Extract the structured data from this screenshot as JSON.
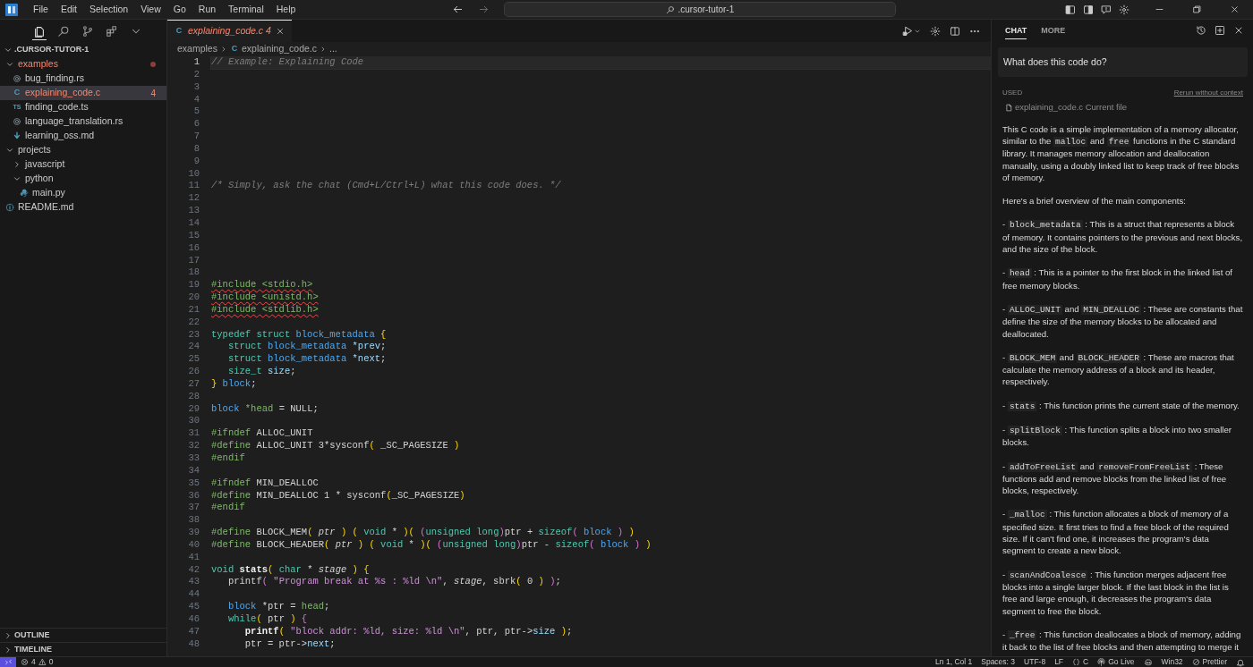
{
  "title_bar": {
    "menu": [
      "File",
      "Edit",
      "Selection",
      "View",
      "Go",
      "Run",
      "Terminal",
      "Help"
    ],
    "search": {
      "value": ".cursor-tutor-1"
    }
  },
  "activity": [
    {
      "kind": "files",
      "selected": true
    },
    {
      "kind": "search",
      "selected": false
    },
    {
      "kind": "source-control",
      "selected": false
    },
    {
      "kind": "extensions",
      "selected": false
    },
    {
      "kind": "more",
      "selected": false
    }
  ],
  "explorer": {
    "title": ".CURSOR-TUTOR-1",
    "expanded": true,
    "tree": [
      {
        "label": "examples",
        "kind": "folder",
        "expanded": true,
        "selected": false,
        "error": true,
        "modified": true,
        "children": [
          {
            "label": "bug_finding.rs",
            "kind": "rust",
            "selected": false,
            "error": false
          },
          {
            "label": "explaining_code.c",
            "kind": "c",
            "icon_text": "C",
            "badge": "4",
            "selected": true,
            "error": true
          },
          {
            "label": "finding_code.ts",
            "kind": "ts",
            "icon_text": "TS",
            "selected": false,
            "error": false
          },
          {
            "label": "language_translation.rs",
            "kind": "rust",
            "selected": false,
            "error": false
          },
          {
            "label": "learning_oss.md",
            "kind": "markdown",
            "selected": false,
            "error": false
          }
        ]
      },
      {
        "label": "projects",
        "kind": "folder",
        "expanded": true,
        "selected": false,
        "error": false,
        "children": [
          {
            "label": "javascript",
            "kind": "folder",
            "expanded": false,
            "selected": false,
            "error": false
          },
          {
            "label": "python",
            "kind": "folder",
            "expanded": true,
            "selected": false,
            "error": false,
            "children": [
              {
                "label": "main.py",
                "kind": "python",
                "selected": false,
                "error": false
              }
            ]
          }
        ]
      },
      {
        "label": "README.md",
        "kind": "info",
        "selected": false,
        "error": false
      }
    ]
  },
  "sidebar_sections": [
    {
      "label": "OUTLINE",
      "expanded": false
    },
    {
      "label": "TIMELINE",
      "expanded": false
    }
  ],
  "editor": {
    "tabs": [
      {
        "label": "explaining_code.c",
        "icon_text": "C",
        "badge": "4",
        "selected": true,
        "error": true
      }
    ],
    "breadcrumb": [
      {
        "label": "examples"
      },
      {
        "label": "explaining_code.c",
        "icon_text": "C"
      },
      {
        "label": "..."
      }
    ],
    "lines": [
      {
        "number": "1",
        "current": true,
        "tokens": [
          {
            "kind": "cm",
            "text": "// Example: Explaining Code"
          }
        ]
      },
      {
        "number": "2"
      },
      {
        "number": "3"
      },
      {
        "number": "4"
      },
      {
        "number": "5"
      },
      {
        "number": "6"
      },
      {
        "number": "7"
      },
      {
        "number": "8"
      },
      {
        "number": "9"
      },
      {
        "number": "10"
      },
      {
        "number": "11",
        "tokens": [
          {
            "kind": "cm",
            "text": "/* Simply, ask the chat (Cmd+L/Ctrl+L) what this code does. */"
          }
        ]
      },
      {
        "number": "12"
      },
      {
        "number": "13"
      },
      {
        "number": "14"
      },
      {
        "number": "15"
      },
      {
        "number": "16"
      },
      {
        "number": "17"
      },
      {
        "number": "18"
      },
      {
        "number": "19",
        "error": true,
        "tokens": [
          {
            "kind": "pp",
            "text": "#include <stdio.h>"
          }
        ]
      },
      {
        "number": "20",
        "error": true,
        "tokens": [
          {
            "kind": "pp",
            "text": "#include <unistd.h>"
          }
        ]
      },
      {
        "number": "21",
        "error": true,
        "tokens": [
          {
            "kind": "pp",
            "text": "#include <stdlib.h>"
          }
        ]
      },
      {
        "number": "22"
      },
      {
        "number": "23",
        "tokens": [
          {
            "kind": "kw",
            "text": "typedef struct "
          },
          {
            "kind": "ty",
            "text": "block_metadata "
          },
          {
            "kind": "y",
            "text": "{"
          }
        ]
      },
      {
        "number": "24",
        "tokens": [
          {
            "kind": "kw",
            "text": "   struct "
          },
          {
            "kind": "ty",
            "text": "block_metadata "
          },
          {
            "kind": "v",
            "text": "*prev"
          },
          {
            "kind": "w",
            "text": ";"
          }
        ]
      },
      {
        "number": "25",
        "tokens": [
          {
            "kind": "kw",
            "text": "   struct "
          },
          {
            "kind": "ty",
            "text": "block_metadata "
          },
          {
            "kind": "v",
            "text": "*next"
          },
          {
            "kind": "w",
            "text": ";"
          }
        ]
      },
      {
        "number": "26",
        "tokens": [
          {
            "kind": "kw",
            "text": "   size_t "
          },
          {
            "kind": "v",
            "text": "size"
          },
          {
            "kind": "w",
            "text": ";"
          }
        ]
      },
      {
        "number": "27",
        "tokens": [
          {
            "kind": "y",
            "text": "}"
          },
          {
            "kind": "ty",
            "text": " block"
          },
          {
            "kind": "w",
            "text": ";"
          }
        ]
      },
      {
        "number": "28"
      },
      {
        "number": "29",
        "tokens": [
          {
            "kind": "ty",
            "text": "block "
          },
          {
            "kind": "pp",
            "text": "*head"
          },
          {
            "kind": "w",
            "text": " = NULL;"
          }
        ]
      },
      {
        "number": "30"
      },
      {
        "number": "31",
        "tokens": [
          {
            "kind": "pp",
            "text": "#ifndef "
          },
          {
            "kind": "w",
            "text": "ALLOC_UNIT"
          }
        ]
      },
      {
        "number": "32",
        "tokens": [
          {
            "kind": "pp",
            "text": "#define "
          },
          {
            "kind": "w",
            "text": "ALLOC_UNIT "
          },
          {
            "kind": "n",
            "text": "3"
          },
          {
            "kind": "w",
            "text": "*sysconf"
          },
          {
            "kind": "y",
            "text": "("
          },
          {
            "kind": "w",
            "text": " _SC_PAGESIZE "
          },
          {
            "kind": "y",
            "text": ")"
          }
        ]
      },
      {
        "number": "33",
        "tokens": [
          {
            "kind": "pp",
            "text": "#endif"
          }
        ]
      },
      {
        "number": "34"
      },
      {
        "number": "35",
        "tokens": [
          {
            "kind": "pp",
            "text": "#ifndef "
          },
          {
            "kind": "w",
            "text": "MIN_DEALLOC"
          }
        ]
      },
      {
        "number": "36",
        "tokens": [
          {
            "kind": "pp",
            "text": "#define "
          },
          {
            "kind": "w",
            "text": "MIN_DEALLOC "
          },
          {
            "kind": "n",
            "text": "1"
          },
          {
            "kind": "w",
            "text": " * sysconf"
          },
          {
            "kind": "y",
            "text": "("
          },
          {
            "kind": "w",
            "text": "_SC_PAGESIZE"
          },
          {
            "kind": "y",
            "text": ")"
          }
        ]
      },
      {
        "number": "37",
        "tokens": [
          {
            "kind": "pp",
            "text": "#endif"
          }
        ]
      },
      {
        "number": "38"
      },
      {
        "number": "39",
        "tokens": [
          {
            "kind": "pp",
            "text": "#define "
          },
          {
            "kind": "w",
            "text": "BLOCK_MEM"
          },
          {
            "kind": "y",
            "text": "( "
          },
          {
            "kind": "it",
            "text": "ptr"
          },
          {
            "kind": "y",
            "text": " ) "
          },
          {
            "kind": "y",
            "text": "( "
          },
          {
            "kind": "kw",
            "text": "void"
          },
          {
            "kind": "w",
            "text": " * "
          },
          {
            "kind": "y",
            "text": ")( "
          },
          {
            "kind": "m",
            "text": "("
          },
          {
            "kind": "kw",
            "text": "unsigned long"
          },
          {
            "kind": "m",
            "text": ")"
          },
          {
            "kind": "w",
            "text": "ptr + "
          },
          {
            "kind": "kw",
            "text": "sizeof"
          },
          {
            "kind": "m",
            "text": "( "
          },
          {
            "kind": "ty",
            "text": "block"
          },
          {
            "kind": "m",
            "text": " )"
          },
          {
            "kind": "y",
            "text": " )"
          }
        ]
      },
      {
        "number": "40",
        "tokens": [
          {
            "kind": "pp",
            "text": "#define "
          },
          {
            "kind": "w",
            "text": "BLOCK_HEADER"
          },
          {
            "kind": "y",
            "text": "( "
          },
          {
            "kind": "it",
            "text": "ptr"
          },
          {
            "kind": "y",
            "text": " ) "
          },
          {
            "kind": "y",
            "text": "( "
          },
          {
            "kind": "kw",
            "text": "void"
          },
          {
            "kind": "w",
            "text": " * "
          },
          {
            "kind": "y",
            "text": ")( "
          },
          {
            "kind": "m",
            "text": "("
          },
          {
            "kind": "kw",
            "text": "unsigned long"
          },
          {
            "kind": "m",
            "text": ")"
          },
          {
            "kind": "w",
            "text": "ptr - "
          },
          {
            "kind": "kw",
            "text": "sizeof"
          },
          {
            "kind": "m",
            "text": "( "
          },
          {
            "kind": "ty",
            "text": "block"
          },
          {
            "kind": "m",
            "text": " )"
          },
          {
            "kind": "y",
            "text": " )"
          }
        ]
      },
      {
        "number": "41"
      },
      {
        "number": "42",
        "tokens": [
          {
            "kind": "kw",
            "text": "void "
          },
          {
            "kind": "fb",
            "text": "stats"
          },
          {
            "kind": "y",
            "text": "("
          },
          {
            "kind": "kw",
            "text": " char"
          },
          {
            "kind": "w",
            "text": " * "
          },
          {
            "kind": "it",
            "text": "stage"
          },
          {
            "kind": "y",
            "text": " ) {"
          }
        ]
      },
      {
        "number": "43",
        "tokens": [
          {
            "kind": "w",
            "text": "   printf"
          },
          {
            "kind": "m",
            "text": "("
          },
          {
            "kind": "s",
            "text": " \"Program break at %s : %ld \\n\""
          },
          {
            "kind": "w",
            "text": ", "
          },
          {
            "kind": "it",
            "text": "stage"
          },
          {
            "kind": "w",
            "text": ", sbrk"
          },
          {
            "kind": "y",
            "text": "("
          },
          {
            "kind": "n",
            "text": " 0 "
          },
          {
            "kind": "y",
            "text": ")"
          },
          {
            "kind": "m",
            "text": " )"
          },
          {
            "kind": "w",
            "text": ";"
          }
        ]
      },
      {
        "number": "44"
      },
      {
        "number": "45",
        "tokens": [
          {
            "kind": "ty",
            "text": "   block "
          },
          {
            "kind": "w",
            "text": "*ptr = "
          },
          {
            "kind": "pp",
            "text": "head"
          },
          {
            "kind": "w",
            "text": ";"
          }
        ]
      },
      {
        "number": "46",
        "tokens": [
          {
            "kind": "kw",
            "text": "   while"
          },
          {
            "kind": "y",
            "text": "("
          },
          {
            "kind": "w",
            "text": " ptr "
          },
          {
            "kind": "y",
            "text": ")"
          },
          {
            "kind": "m",
            "text": " {"
          }
        ]
      },
      {
        "number": "47",
        "tokens": [
          {
            "kind": "fb",
            "text": "      printf"
          },
          {
            "kind": "y",
            "text": "("
          },
          {
            "kind": "s",
            "text": " \"block addr: %ld, size: %ld \\n\""
          },
          {
            "kind": "w",
            "text": ", ptr, ptr->"
          },
          {
            "kind": "v",
            "text": "size"
          },
          {
            "kind": "y",
            "text": " )"
          },
          {
            "kind": "w",
            "text": ";"
          }
        ]
      },
      {
        "number": "48",
        "tokens": [
          {
            "kind": "w",
            "text": "      ptr = ptr->"
          },
          {
            "kind": "v",
            "text": "next"
          },
          {
            "kind": "w",
            "text": ";"
          }
        ]
      }
    ]
  },
  "chat": {
    "tabs": [
      {
        "label": "CHAT",
        "selected": true
      },
      {
        "label": "MORE",
        "selected": false
      }
    ],
    "question": "What does this code do?",
    "used_label": "USED",
    "rerun_link": "Rerun without context",
    "context_file": {
      "name": "explaining_code.c",
      "note": "Current file"
    },
    "paragraphs": [
      [
        {
          "kind": "text",
          "text": "This C code is a simple implementation of a memory allocator, similar to the "
        },
        {
          "kind": "code",
          "text": "malloc"
        },
        {
          "kind": "text",
          "text": " and "
        },
        {
          "kind": "code",
          "text": "free"
        },
        {
          "kind": "text",
          "text": " functions in the C standard library. It manages memory allocation and deallocation manually, using a doubly linked list to keep track of free blocks of memory."
        }
      ],
      [
        {
          "kind": "text",
          "text": "Here's a brief overview of the main components:"
        }
      ],
      [
        {
          "kind": "text",
          "text": "- "
        },
        {
          "kind": "code",
          "text": "block_metadata"
        },
        {
          "kind": "text",
          "text": " : This is a struct that represents a block of memory. It contains pointers to the previous and next blocks, and the size of the block."
        }
      ],
      [
        {
          "kind": "text",
          "text": "- "
        },
        {
          "kind": "code",
          "text": "head"
        },
        {
          "kind": "text",
          "text": " : This is a pointer to the first block in the linked list of free memory blocks."
        }
      ],
      [
        {
          "kind": "text",
          "text": "- "
        },
        {
          "kind": "code",
          "text": "ALLOC_UNIT"
        },
        {
          "kind": "text",
          "text": " and "
        },
        {
          "kind": "code",
          "text": "MIN_DEALLOC"
        },
        {
          "kind": "text",
          "text": " : These are constants that define the size of the memory blocks to be allocated and deallocated."
        }
      ],
      [
        {
          "kind": "text",
          "text": "- "
        },
        {
          "kind": "code",
          "text": "BLOCK_MEM"
        },
        {
          "kind": "text",
          "text": " and "
        },
        {
          "kind": "code",
          "text": "BLOCK_HEADER"
        },
        {
          "kind": "text",
          "text": " : These are macros that calculate the memory address of a block and its header, respectively."
        }
      ],
      [
        {
          "kind": "text",
          "text": "- "
        },
        {
          "kind": "code",
          "text": "stats"
        },
        {
          "kind": "text",
          "text": " : This function prints the current state of the memory."
        }
      ],
      [
        {
          "kind": "text",
          "text": "- "
        },
        {
          "kind": "code",
          "text": "splitBlock"
        },
        {
          "kind": "text",
          "text": " : This function splits a block into two smaller blocks."
        }
      ],
      [
        {
          "kind": "text",
          "text": "- "
        },
        {
          "kind": "code",
          "text": "addToFreeList"
        },
        {
          "kind": "text",
          "text": " and "
        },
        {
          "kind": "code",
          "text": "removeFromFreeList"
        },
        {
          "kind": "text",
          "text": " : These functions add and remove blocks from the linked list of free blocks, respectively."
        }
      ],
      [
        {
          "kind": "text",
          "text": "- "
        },
        {
          "kind": "code",
          "text": "_malloc"
        },
        {
          "kind": "text",
          "text": " : This function allocates a block of memory of a specified size. It first tries to find a free block of the required size. If it can't find one, it increases the program's data segment to create a new block."
        }
      ],
      [
        {
          "kind": "text",
          "text": "- "
        },
        {
          "kind": "code",
          "text": "scanAndCoalesce"
        },
        {
          "kind": "text",
          "text": " : This function merges adjacent free blocks into a single larger block. If the last block in the list is free and large enough, it decreases the program's data segment to free the block."
        }
      ],
      [
        {
          "kind": "text",
          "text": "- "
        },
        {
          "kind": "code",
          "text": "_free"
        },
        {
          "kind": "text",
          "text": " : This function deallocates a block of memory, adding it back to the list of free blocks and then attempting to merge it"
        }
      ]
    ]
  },
  "status_bar": {
    "errors": "4",
    "warnings": "0",
    "items": [
      {
        "kind": "text",
        "text": "Ln 1, Col 1"
      },
      {
        "kind": "text",
        "text": "Spaces: 3"
      },
      {
        "kind": "text",
        "text": "UTF-8"
      },
      {
        "kind": "text",
        "text": "LF"
      },
      {
        "kind": "braces",
        "text": "C"
      },
      {
        "kind": "broadcast",
        "text": "Go Live"
      },
      {
        "kind": "copilot"
      },
      {
        "kind": "text",
        "text": "Win32"
      },
      {
        "kind": "prohibited",
        "text": "Prettier"
      },
      {
        "kind": "bell"
      }
    ]
  }
}
